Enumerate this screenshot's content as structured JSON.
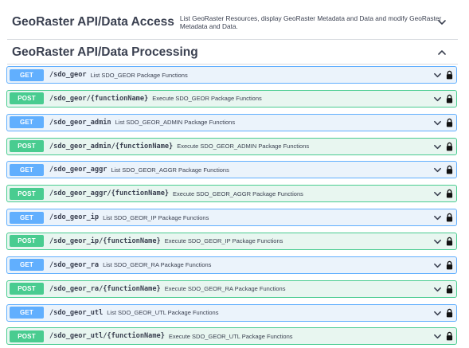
{
  "sections": [
    {
      "title": "GeoRaster API/Data Access",
      "description": "List GeoRaster Resources, display GeoRaster Metadata and Data and modify GeoRaster Metadata and Data.",
      "expanded": false
    },
    {
      "title": "GeoRaster API/Data Processing",
      "expanded": true
    }
  ],
  "operations": [
    {
      "method": "GET",
      "path": "/sdo_geor",
      "summary": "List SDO_GEOR Package Functions"
    },
    {
      "method": "POST",
      "path": "/sdo_geor/{functionName}",
      "summary": "Execute SDO_GEOR Package Functions"
    },
    {
      "method": "GET",
      "path": "/sdo_geor_admin",
      "summary": "List SDO_GEOR_ADMIN Package Functions"
    },
    {
      "method": "POST",
      "path": "/sdo_geor_admin/{functionName}",
      "summary": "Execute SDO_GEOR_ADMIN Package Functions"
    },
    {
      "method": "GET",
      "path": "/sdo_geor_aggr",
      "summary": "List SDO_GEOR_AGGR Package Functions"
    },
    {
      "method": "POST",
      "path": "/sdo_geor_aggr/{functionName}",
      "summary": "Execute SDO_GEOR_AGGR Package Functions"
    },
    {
      "method": "GET",
      "path": "/sdo_geor_ip",
      "summary": "List SDO_GEOR_IP Package Functions"
    },
    {
      "method": "POST",
      "path": "/sdo_geor_ip/{functionName}",
      "summary": "Execute SDO_GEOR_IP Package Functions"
    },
    {
      "method": "GET",
      "path": "/sdo_geor_ra",
      "summary": "List SDO_GEOR_RA Package Functions"
    },
    {
      "method": "POST",
      "path": "/sdo_geor_ra/{functionName}",
      "summary": "Execute SDO_GEOR_RA Package Functions"
    },
    {
      "method": "GET",
      "path": "/sdo_geor_utl",
      "summary": "List SDO_GEOR_UTL Package Functions"
    },
    {
      "method": "POST",
      "path": "/sdo_geor_utl/{functionName}",
      "summary": "Execute SDO_GEOR_UTL Package Functions"
    }
  ],
  "icons": {
    "collapsed_chevron": "chevron-down-icon",
    "expanded_chevron": "chevron-up-icon",
    "operation_chevron": "chevron-down-icon",
    "lock": "lock-icon"
  },
  "colors": {
    "get_badge": "#61affe",
    "get_bg": "#ebf3fb",
    "post_badge": "#49cc90",
    "post_bg": "#e8f6f0",
    "text": "#3b4151"
  }
}
